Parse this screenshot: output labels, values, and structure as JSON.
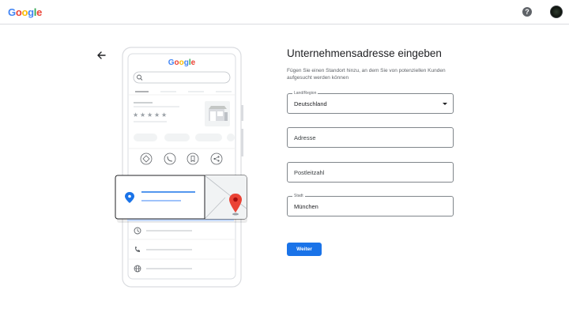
{
  "header": {
    "logo_letters": [
      {
        "ch": "G",
        "color": "#4285F4"
      },
      {
        "ch": "o",
        "color": "#EA4335"
      },
      {
        "ch": "o",
        "color": "#FBBC05"
      },
      {
        "ch": "g",
        "color": "#4285F4"
      },
      {
        "ch": "l",
        "color": "#34A853"
      },
      {
        "ch": "e",
        "color": "#EA4335"
      }
    ],
    "help_glyph": "?",
    "help_icon": "help-circle-icon",
    "avatar_icon": "user-avatar"
  },
  "illustration": {
    "logo_text": "Google",
    "search_icon": "search-icon",
    "action_icons": [
      "directions-icon",
      "phone-icon",
      "bookmark-icon",
      "share-icon"
    ],
    "detail_icons": [
      "clock-icon",
      "phone-icon",
      "globe-icon"
    ],
    "marker_icons": [
      "location-pin-icon",
      "map-pin-icon"
    ],
    "rating_stars": 5
  },
  "form": {
    "title": "Unternehmensadresse eingeben",
    "subtitle": "Fügen Sie einen Standort hinzu, an dem Sie von potenziellen Kunden aufgesucht werden können",
    "country_label": "Land/Region",
    "country_value": "Deutschland",
    "address_placeholder": "Adresse",
    "postal_placeholder": "Postleitzahl",
    "city_label": "Stadt",
    "city_value": "München",
    "next_button": "Weiter"
  },
  "colors": {
    "primary": "#1a73e8",
    "pin_red": "#EA4335",
    "border": "#dadce0"
  }
}
